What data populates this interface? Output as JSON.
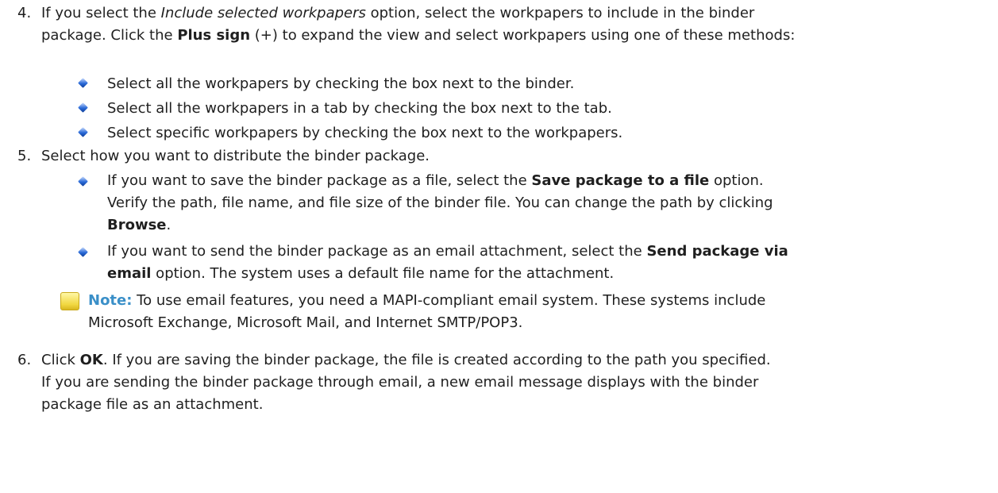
{
  "step4": {
    "number": "4.",
    "line1_a": "If you select the ",
    "line1_b": "Include selected workpapers",
    "line1_c": " option, select the workpapers to include in the binder",
    "line2_a": "package. Click the ",
    "line2_b": "Plus sign",
    "line2_c": " (+) to expand the view and select workpapers using one of these methods:",
    "bullets": [
      "Select all the workpapers by checking the box next to the binder.",
      "Select all the workpapers in a tab by checking the box next to the tab.",
      "Select specific workpapers by checking the box next to the workpapers."
    ]
  },
  "step5": {
    "number": "5.",
    "text": "Select how you want to distribute the binder package.",
    "bullet1": {
      "a": "If you want to save the binder package as a file, select the ",
      "b": "Save package to a file",
      "c": " option.",
      "line2": "Verify the path, file name, and file size of the binder file. You can change the path by clicking",
      "line3_b": "Browse",
      "line3_c": "."
    },
    "bullet2": {
      "a": "If you want to send the binder package as an email attachment, select the ",
      "b": "Send package via",
      "line2_b": "email",
      "line2_c": " option. The system uses a default file name for the attachment."
    },
    "note": {
      "label": "Note:",
      "text1": " To use email features, you need a MAPI-compliant email system. These systems include",
      "text2": "Microsoft Exchange, Microsoft Mail, and Internet SMTP/POP3."
    }
  },
  "step6": {
    "number": "6.",
    "a": "Click ",
    "b": "OK",
    "c": ". If you are saving the binder package, the file is created according to the path you specified.",
    "line2": "If you are sending the binder package through email, a new email message displays with the binder",
    "line3": "package file as an attachment."
  }
}
